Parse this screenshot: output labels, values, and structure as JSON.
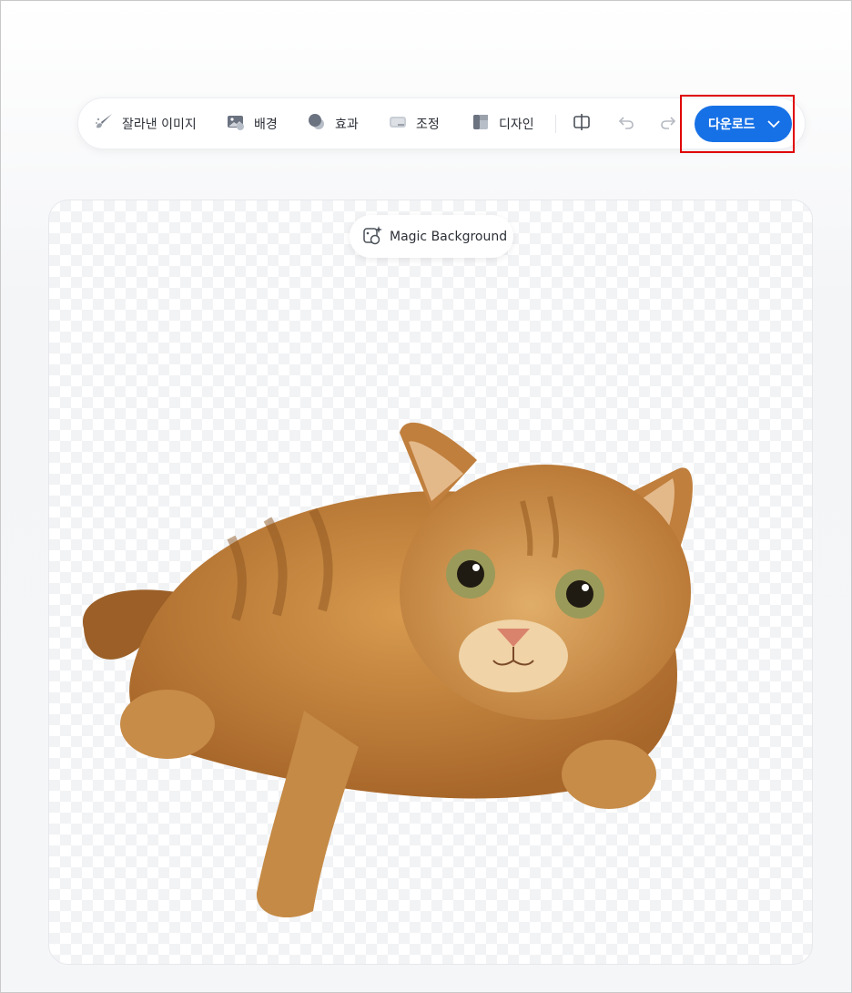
{
  "toolbar": {
    "items": [
      {
        "label": "잘라낸 이미지",
        "icon": "brush-icon"
      },
      {
        "label": "배경",
        "icon": "image-icon"
      },
      {
        "label": "효과",
        "icon": "circles-icon"
      },
      {
        "label": "조정",
        "icon": "adjust-icon"
      },
      {
        "label": "디자인",
        "icon": "layout-icon"
      }
    ],
    "compare_icon": "compare-icon",
    "undo_icon": "undo-icon",
    "redo_icon": "redo-icon",
    "download_label": "다운로드",
    "download_color": "#1771e6"
  },
  "canvas": {
    "magic_label": "Magic Background",
    "subject": "cat"
  }
}
